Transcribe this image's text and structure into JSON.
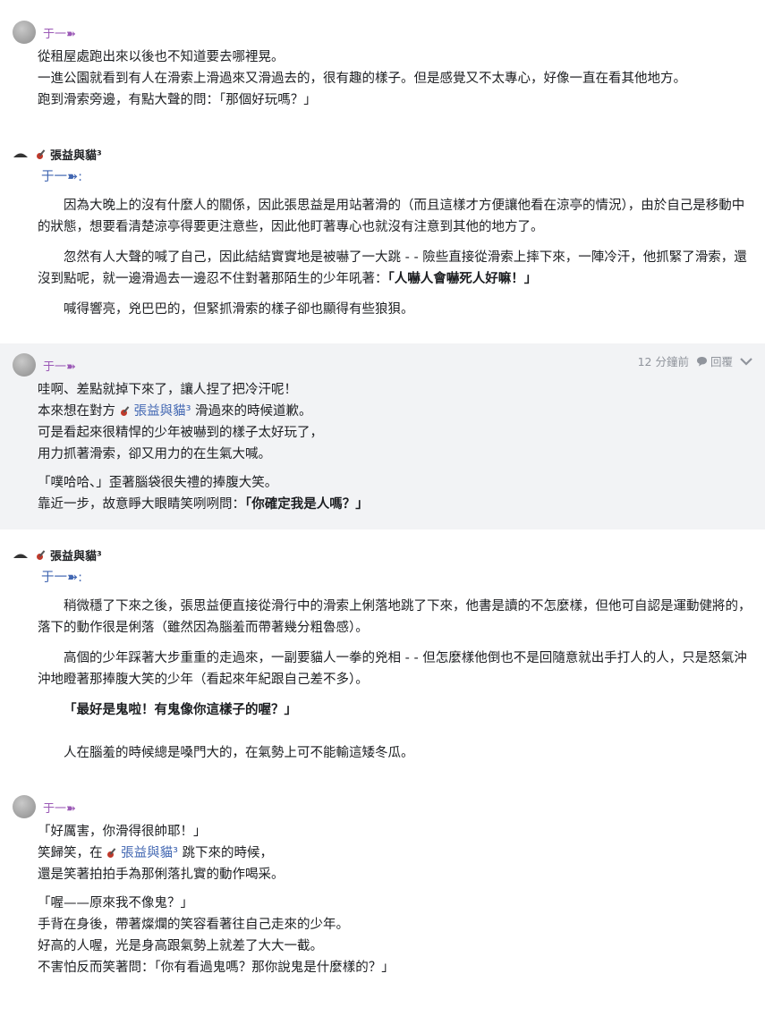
{
  "posts": [
    {
      "author": "于一➽",
      "lines": [
        "從租屋處跑出來以後也不知道要去哪裡晃。",
        "一進公園就看到有人在滑索上滑過來又滑過去的，很有趣的樣子。但是感覺又不太專心，好像一直在看其他地方。",
        "跑到滑索旁邊，有點大聲的問：「那個好玩嗎？」"
      ]
    },
    {
      "author": "張益與貓³",
      "reply_to": "于一➽:",
      "paragraphs": [
        "因為大晚上的沒有什麼人的關係，因此張思益是用站著滑的（而且這樣才方便讓他看在涼亭的情況），由於自己是移動中的狀態，想要看清楚涼亭得要更注意些，因此他盯著專心也就沒有注意到其他的地方了。",
        "忽然有人大聲的喊了自己，因此結結實實地是被嚇了一大跳 - - 險些直接從滑索上摔下來，一陣冷汗，他抓緊了滑索，還沒到點呢，就一邊滑過去一邊忍不住對著那陌生的少年吼著：",
        "「人嚇人會嚇死人好嘛！」",
        "喊得響亮，兇巴巴的，但緊抓滑索的樣子卻也顯得有些狼狽。"
      ]
    },
    {
      "author": "于一➽",
      "time": "12 分鐘前",
      "reply_label": "回覆",
      "lines1": [
        "哇啊、差點就掉下來了，讓人捏了把冷汗呢！",
        "本來想在對方 ",
        "張益與貓³",
        " 滑過來的時候道歉。",
        "可是看起來很精悍的少年被嚇到的樣子太好玩了，",
        "用力抓著滑索，卻又用力的在生氣大喊。"
      ],
      "lines2": [
        "「噗哈哈、」歪著腦袋很失禮的捧腹大笑。",
        "靠近一步，故意睜大眼睛笑咧咧問：",
        "「你確定我是人嗎？」"
      ]
    },
    {
      "author": "張益與貓³",
      "reply_to": "于一➽:",
      "paragraphs": [
        "稍微穩了下來之後，張思益便直接從滑行中的滑索上俐落地跳了下來，他書是讀的不怎麼樣，但他可自認是運動健將的，落下的動作很是俐落（雖然因為腦羞而帶著幾分粗魯感）。",
        "高個的少年踩著大步重重的走過來，一副要貓人一拳的兇相 - - 但怎麼樣他倒也不是回隨意就出手打人的人，只是怒氣沖沖地瞪著那捧腹大笑的少年（看起來年紀跟自己差不多）。",
        "「最好是鬼啦！有鬼像你這樣子的喔？」",
        "人在腦羞的時候總是嗓門大的，在氣勢上可不能輸這矮冬瓜。"
      ]
    },
    {
      "author": "于一➽",
      "lines1": [
        "「好厲害，你滑得很帥耶！」",
        "笑歸笑，在 ",
        "張益與貓³",
        " 跳下來的時候，",
        "還是笑著拍拍手為那俐落扎實的動作喝采。"
      ],
      "lines2": [
        "「喔——原來我不像鬼？」",
        "手背在身後，帶著燦爛的笑容看著往自己走來的少年。",
        "好高的人喔，光是身高跟氣勢上就差了大大一截。",
        "不害怕反而笑著問：「你有看過鬼嗎？那你說鬼是什麼樣的？」"
      ]
    }
  ]
}
